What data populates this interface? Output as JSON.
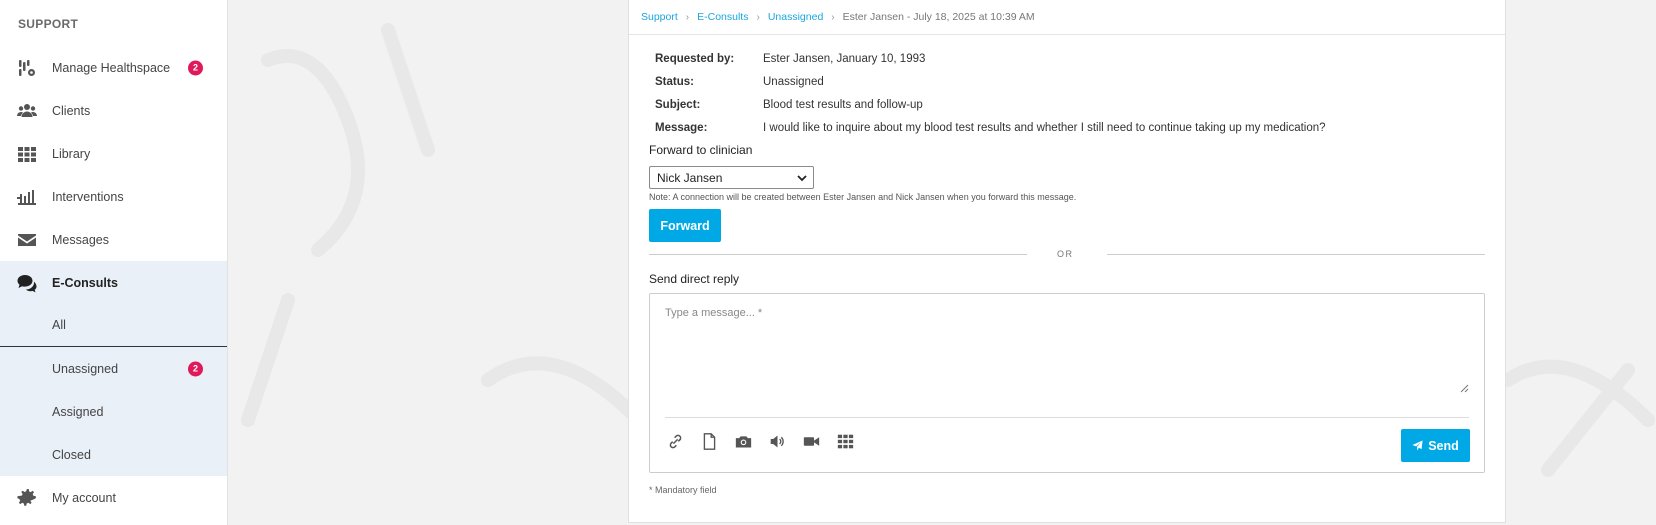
{
  "sidebar": {
    "title": "SUPPORT",
    "items": [
      {
        "label": "Manage Healthspace",
        "icon": "healthspace-icon",
        "badge": "2"
      },
      {
        "label": "Clients",
        "icon": "users-icon"
      },
      {
        "label": "Library",
        "icon": "grid-icon"
      },
      {
        "label": "Interventions",
        "icon": "interventions-icon"
      },
      {
        "label": "Messages",
        "icon": "envelope-icon"
      },
      {
        "label": "E-Consults",
        "icon": "chat-bubbles-icon"
      }
    ],
    "econsults_sub": [
      {
        "label": "All"
      },
      {
        "label": "Unassigned",
        "badge": "2"
      },
      {
        "label": "Assigned"
      },
      {
        "label": "Closed"
      }
    ],
    "account": {
      "label": "My account",
      "icon": "gear-icon"
    }
  },
  "breadcrumb": {
    "items": [
      "Support",
      "E-Consults",
      "Unassigned"
    ],
    "current": "Ester Jansen - July 18, 2025 at 10:39 AM"
  },
  "details": {
    "requested_by_label": "Requested by:",
    "requested_by": "Ester Jansen, January 10, 1993",
    "status_label": "Status:",
    "status": "Unassigned",
    "subject_label": "Subject:",
    "subject": "Blood test results and follow-up",
    "message_label": "Message:",
    "message": "I would like to inquire about my blood test results and whether I still need to continue taking up my medication?"
  },
  "forward": {
    "label": "Forward to clinician",
    "selected": "Nick Jansen",
    "note": "Note: A connection will be created between Ester Jansen and Nick Jansen when you forward this message.",
    "button": "Forward"
  },
  "or_text": "OR",
  "reply": {
    "label": "Send direct reply",
    "placeholder": "Type a message... *",
    "send_button": "Send",
    "tools": [
      "link-icon",
      "file-icon",
      "camera-icon",
      "audio-icon",
      "video-icon",
      "apps-grid-icon"
    ]
  },
  "mandatory_note": "* Mandatory field",
  "colors": {
    "accent": "#00a9e6",
    "link": "#1ba6de",
    "badge": "#e0195a",
    "sidebar_active": "#e9f0f7"
  }
}
